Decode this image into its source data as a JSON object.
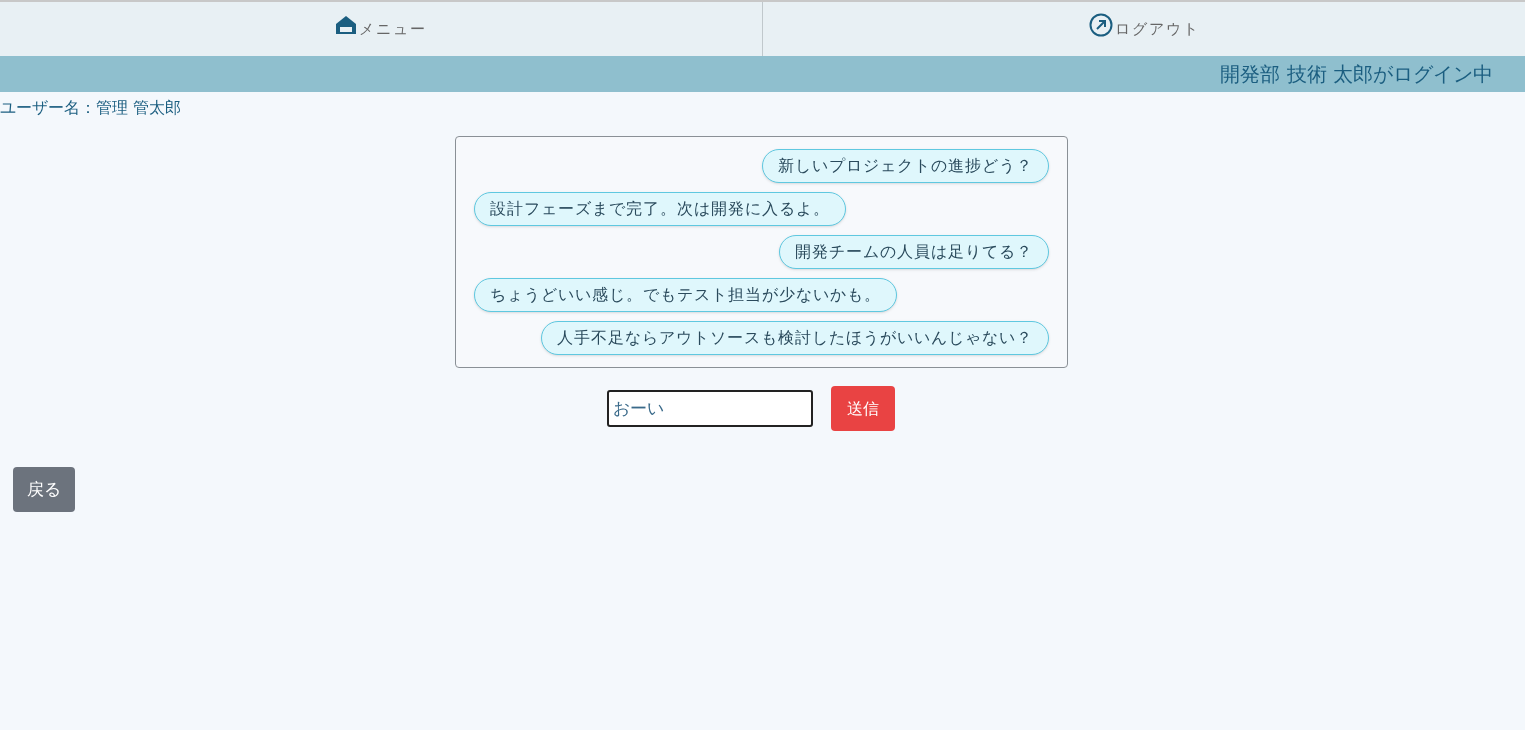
{
  "nav": [
    {
      "label": "メニュー"
    },
    {
      "label": "ログアウト"
    }
  ],
  "banner": "開発部 技術 太郎がログイン中",
  "user_label": "ユーザー名：管理 管太郎",
  "messages": [
    {
      "kind": "outgoing",
      "text": "新しいプロジェクトの進捗どう？"
    },
    {
      "kind": "incoming",
      "text": "設計フェーズまで完了。次は開発に入るよ。"
    },
    {
      "kind": "outgoing",
      "text": "開発チームの人員は足りてる？"
    },
    {
      "kind": "incoming",
      "text": "ちょうどいい感じ。でもテスト担当が少ないかも。"
    },
    {
      "kind": "outgoing",
      "text": "人手不足ならアウトソースも検討したほうがいいんじゃない？"
    }
  ],
  "message_input": {
    "value": "おーい"
  },
  "send_button": "送信",
  "back_button": "戻る"
}
